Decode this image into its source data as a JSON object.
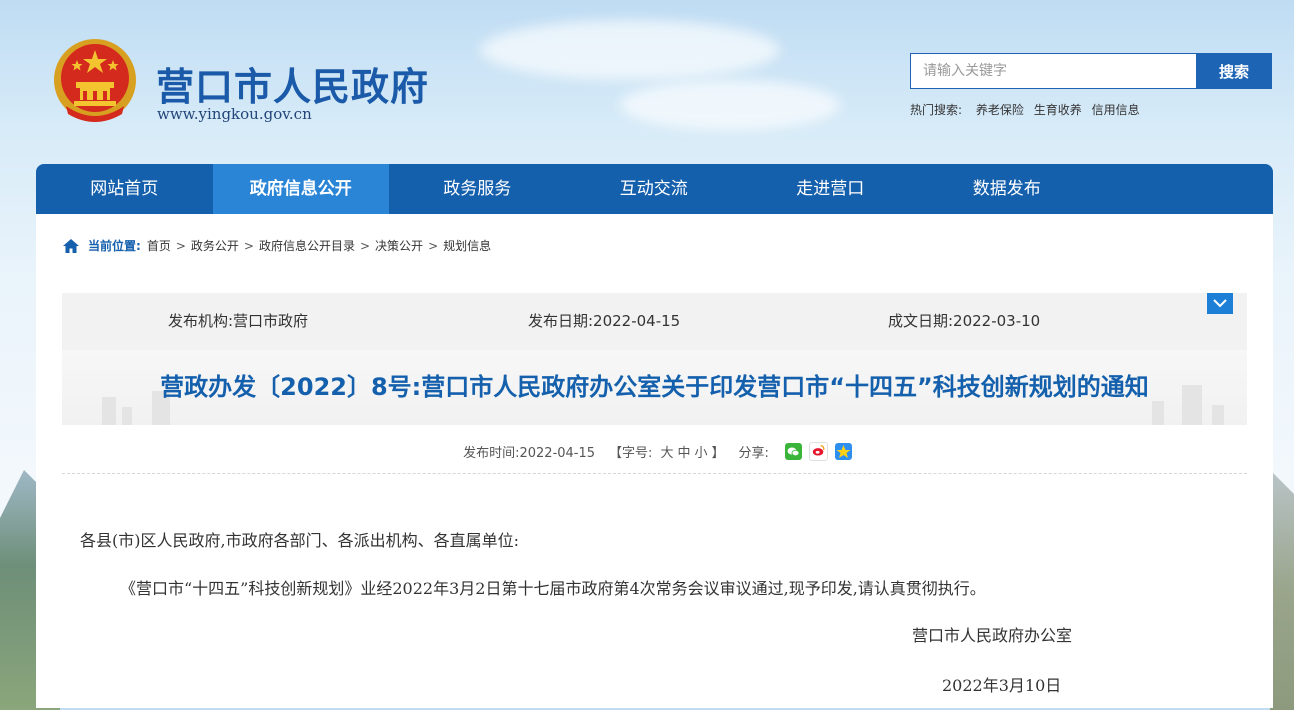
{
  "header": {
    "site_title": "营口市人民政府",
    "site_url": "www.yingkou.gov.cn"
  },
  "search": {
    "placeholder": "请输入关键字",
    "button_label": "搜索",
    "hot_label": "热门搜索:",
    "hot_terms": [
      "养老保险",
      "生育收养",
      "信用信息"
    ]
  },
  "nav": {
    "items": [
      {
        "label": "网站首页"
      },
      {
        "label": "政府信息公开",
        "active": true
      },
      {
        "label": "政务服务"
      },
      {
        "label": "互动交流"
      },
      {
        "label": "走进营口"
      },
      {
        "label": "数据发布"
      }
    ]
  },
  "breadcrumb": {
    "label": "当前位置:",
    "items": [
      "首页",
      "政务公开",
      "政府信息公开目录",
      "决策公开",
      "规划信息"
    ],
    "separator": ">"
  },
  "meta": {
    "publisher": "发布机构:营口市政府",
    "publish_date": "发布日期:2022-04-15",
    "written_date": "成文日期:2022-03-10"
  },
  "document": {
    "title": "营政办发〔2022〕8号:营口市人民政府办公室关于印发营口市“十四五”科技创新规划的通知",
    "publish_time": "发布时间:2022-04-15",
    "font_size_label": "【字号:",
    "font_large": "大",
    "font_medium": "中",
    "font_small": "小",
    "font_size_close": "】",
    "share_label": "分享:",
    "salutation": "各县(市)区人民政府,市政府各部门、各派出机构、各直属单位:",
    "paragraph": "《营口市“十四五”科技创新规划》业经2022年3月2日第十七届市政府第4次常务会议审议通过,现予印发,请认真贯彻执行。",
    "signature_org": "营口市人民政府办公室",
    "signature_date": "2022年3月10日"
  },
  "colors": {
    "brand_blue": "#1560ad",
    "nav_active": "#2a85d6",
    "title_blue": "#1560ad"
  }
}
